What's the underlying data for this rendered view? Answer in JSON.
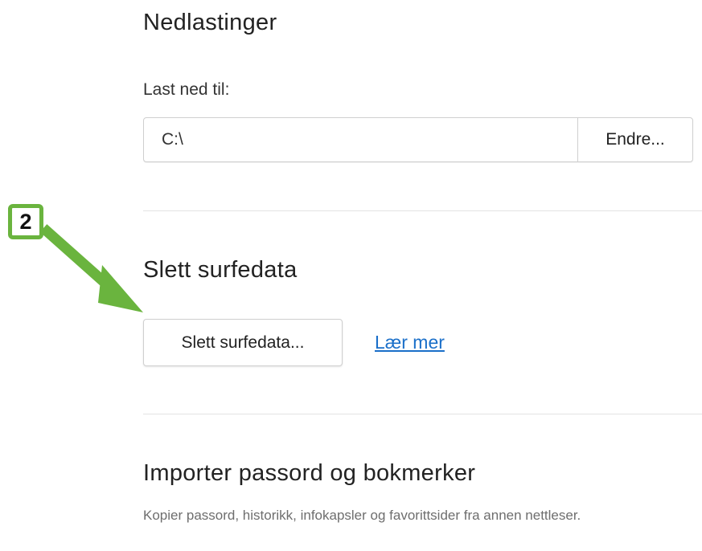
{
  "downloads": {
    "title": "Nedlastinger",
    "label": "Last ned til:",
    "path_value": "C:\\",
    "change_label": "Endre..."
  },
  "clear_data": {
    "title": "Slett surfedata",
    "button_label": "Slett surfedata...",
    "learn_more_label": "Lær mer"
  },
  "import": {
    "title": "Importer passord og bokmerker",
    "description": "Kopier passord, historikk, infokapsler og favorittsider fra annen nettleser."
  },
  "annotation": {
    "step_number": "2",
    "color": "#6ab43e"
  }
}
